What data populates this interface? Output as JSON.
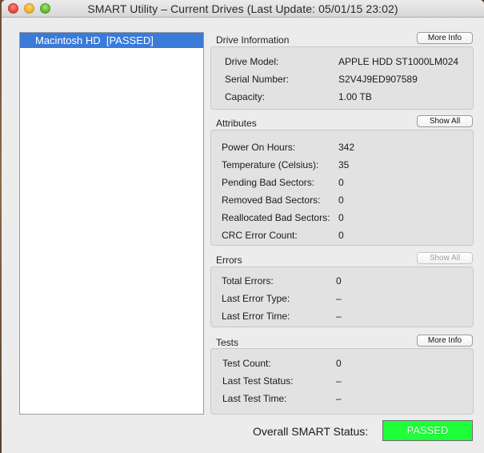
{
  "window": {
    "title": "SMART Utility – Current Drives (Last Update: 05/01/15 23:02)"
  },
  "sidebar": {
    "items": [
      {
        "label": "Macintosh HD  [PASSED]",
        "selected": true
      }
    ]
  },
  "drive_info": {
    "heading": "Drive Information",
    "button": "More Info",
    "rows": [
      {
        "label": "Drive Model:",
        "value": "APPLE HDD ST1000LM024"
      },
      {
        "label": "Serial Number:",
        "value": "S2V4J9ED907589"
      },
      {
        "label": "Capacity:",
        "value": "1.00 TB"
      }
    ]
  },
  "attributes": {
    "heading": "Attributes",
    "button": "Show All",
    "rows": [
      {
        "label": "Power On Hours:",
        "value": "342"
      },
      {
        "label": "Temperature (Celsius):",
        "value": "35"
      },
      {
        "label": "Pending Bad Sectors:",
        "value": "0"
      },
      {
        "label": "Removed Bad Sectors:",
        "value": "0"
      },
      {
        "label": "Reallocated Bad Sectors:",
        "value": "0"
      },
      {
        "label": "CRC Error Count:",
        "value": "0"
      }
    ]
  },
  "errors": {
    "heading": "Errors",
    "button": "Show All",
    "button_enabled": false,
    "rows": [
      {
        "label": "Total Errors:",
        "value": "0"
      },
      {
        "label": "Last Error Type:",
        "value": "–"
      },
      {
        "label": "Last Error Time:",
        "value": "–"
      }
    ]
  },
  "tests": {
    "heading": "Tests",
    "button": "More Info",
    "rows": [
      {
        "label": "Test Count:",
        "value": "0"
      },
      {
        "label": "Last Test Status:",
        "value": "–"
      },
      {
        "label": "Last Test Time:",
        "value": "–"
      }
    ]
  },
  "overall": {
    "label": "Overall SMART Status:",
    "status": "PASSED",
    "status_color": "#1eff3a"
  }
}
